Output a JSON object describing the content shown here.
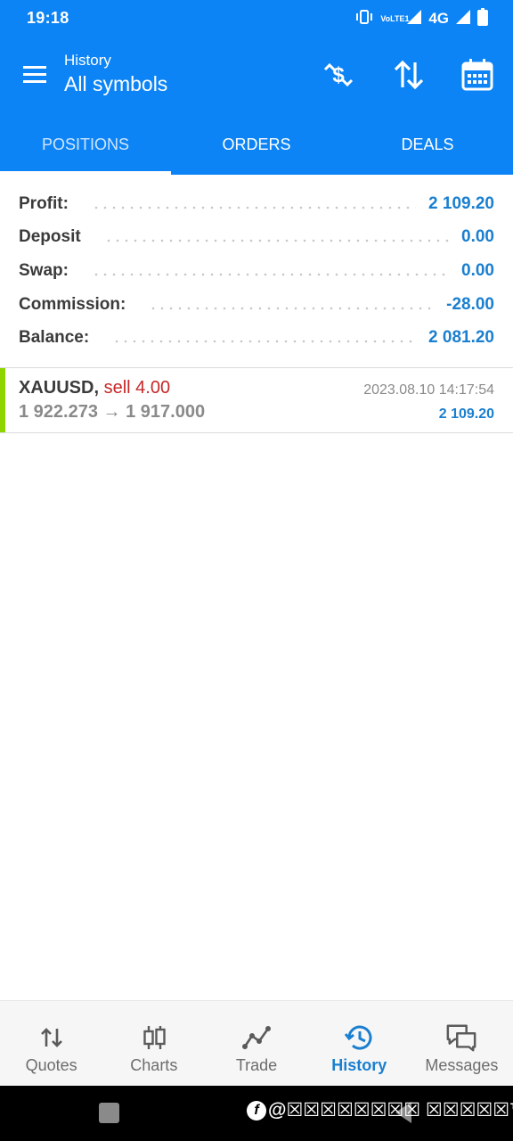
{
  "status_bar": {
    "time": "19:18",
    "lte_label": "VoLTE1",
    "network": "4G",
    "icons": [
      "vibrate-icon",
      "volte-icon",
      "signal-icon",
      "network-4g-icon",
      "signal-icon",
      "battery-icon"
    ]
  },
  "toolbar": {
    "subtitle": "History",
    "title": "All symbols",
    "icons": [
      "menu-icon",
      "dollar-exchange-icon",
      "sort-icon",
      "calendar-icon"
    ]
  },
  "tabs": [
    {
      "label": "POSITIONS",
      "active": true
    },
    {
      "label": "ORDERS",
      "active": false
    },
    {
      "label": "DEALS",
      "active": false
    }
  ],
  "summary": [
    {
      "label": "Profit:",
      "value": "2 109.20"
    },
    {
      "label": "Deposit",
      "value": "0.00"
    },
    {
      "label": "Swap:",
      "value": "0.00"
    },
    {
      "label": "Commission:",
      "value": "-28.00"
    },
    {
      "label": "Balance:",
      "value": "2 081.20"
    }
  ],
  "positions": [
    {
      "symbol": "XAUUSD,",
      "type": "sell 4.00",
      "prices": "1 922.273 → 1 917.000",
      "time": "2023.08.10 14:17:54",
      "profit": "2 109.20"
    }
  ],
  "bottom_nav": [
    {
      "label": "Quotes",
      "icon": "quotes-arrows-icon",
      "active": false
    },
    {
      "label": "Charts",
      "icon": "candlestick-icon",
      "active": false
    },
    {
      "label": "Trade",
      "icon": "trend-line-icon",
      "active": false
    },
    {
      "label": "History",
      "icon": "history-clock-icon",
      "active": true
    },
    {
      "label": "Messages",
      "icon": "chat-bubbles-icon",
      "active": false
    }
  ],
  "watermark": {
    "logo": "f",
    "text": "@☒☒☒☒☒☒☒☒ ☒☒☒☒☒™"
  },
  "colors": {
    "app_bar": "#0d84f5",
    "value_blue": "#1a7fcf",
    "sell_red": "#c62828",
    "position_bar_green": "#8fd400"
  }
}
